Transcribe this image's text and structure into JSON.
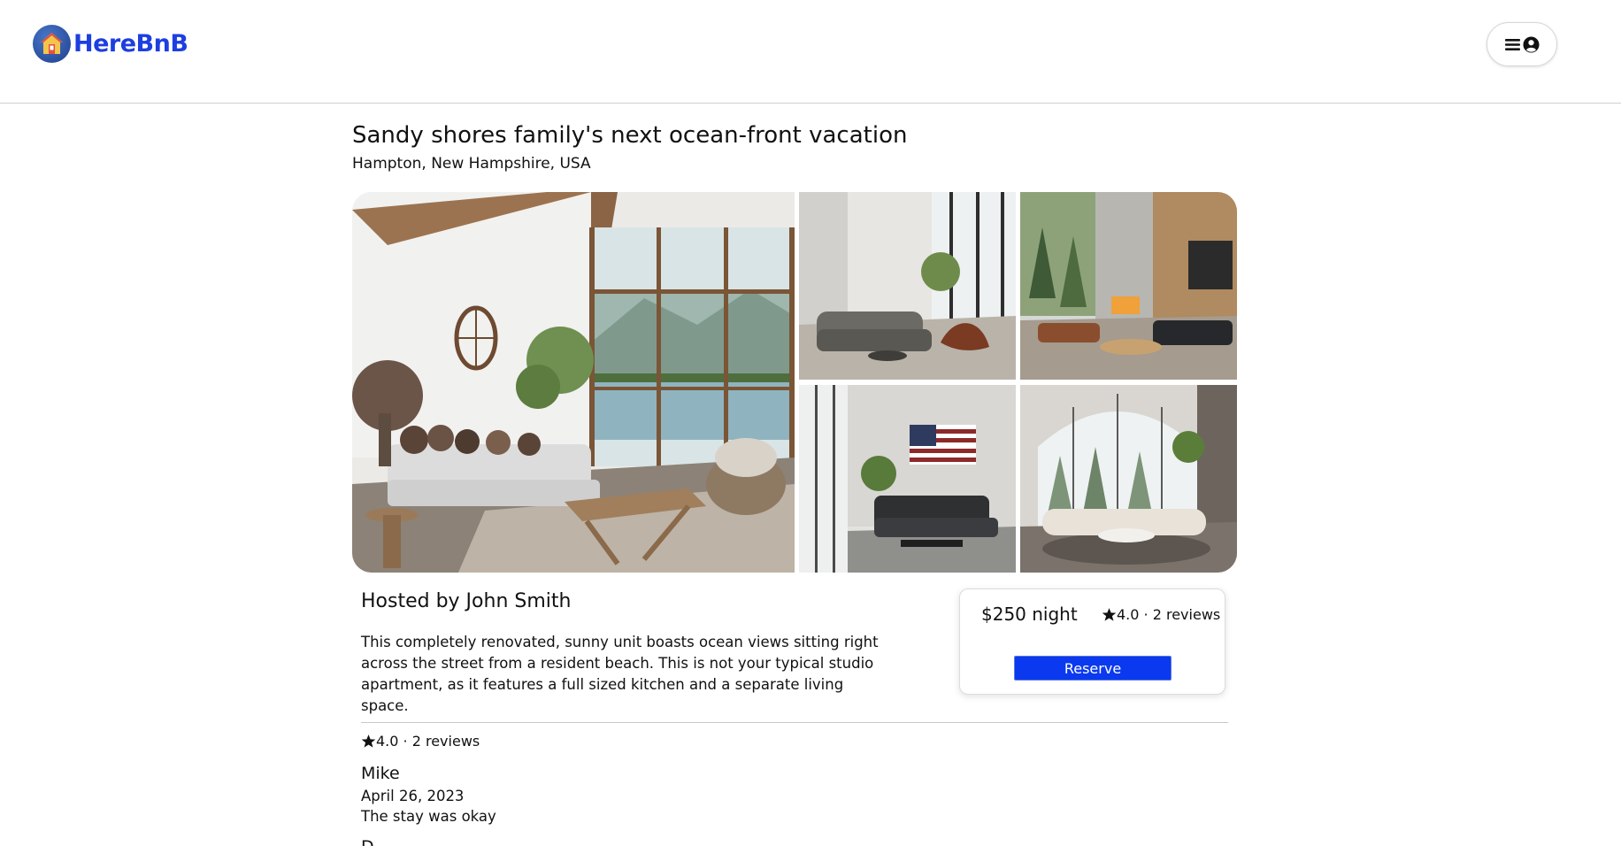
{
  "brand": {
    "name": "HereBnB",
    "color": "#1d3fe0"
  },
  "header": {
    "menu_icon": "hamburger-icon",
    "user_icon": "user-circle-icon"
  },
  "listing": {
    "title": "Sandy shores family's next ocean-front vacation",
    "location": "Hampton, New Hampshire, USA",
    "photos": [
      "living room with mountain lake view",
      "modern lounge with tall windows",
      "living room with fireplace and forest view",
      "living room with american flag wall art",
      "living room with arched windows and snowy forest"
    ],
    "host": "Hosted by John Smith",
    "description": "This completely renovated, sunny unit boasts ocean views sitting right across the street from a resident beach. This is not your typical studio apartment, as it features a full sized kitchen and a separate living space."
  },
  "booking": {
    "price": "$250 night",
    "rating": "4.0",
    "separator": " · ",
    "reviews_count": "2 reviews",
    "reserve_label": "Reserve",
    "accent_color": "#0a39f0"
  },
  "reviews": {
    "rating": "4.0",
    "separator": " · ",
    "count": "2 reviews",
    "items": [
      {
        "name": "Mike",
        "date": "April 26, 2023",
        "text": "The stay was okay"
      },
      {
        "name": "D",
        "date": "",
        "text": ""
      }
    ]
  }
}
